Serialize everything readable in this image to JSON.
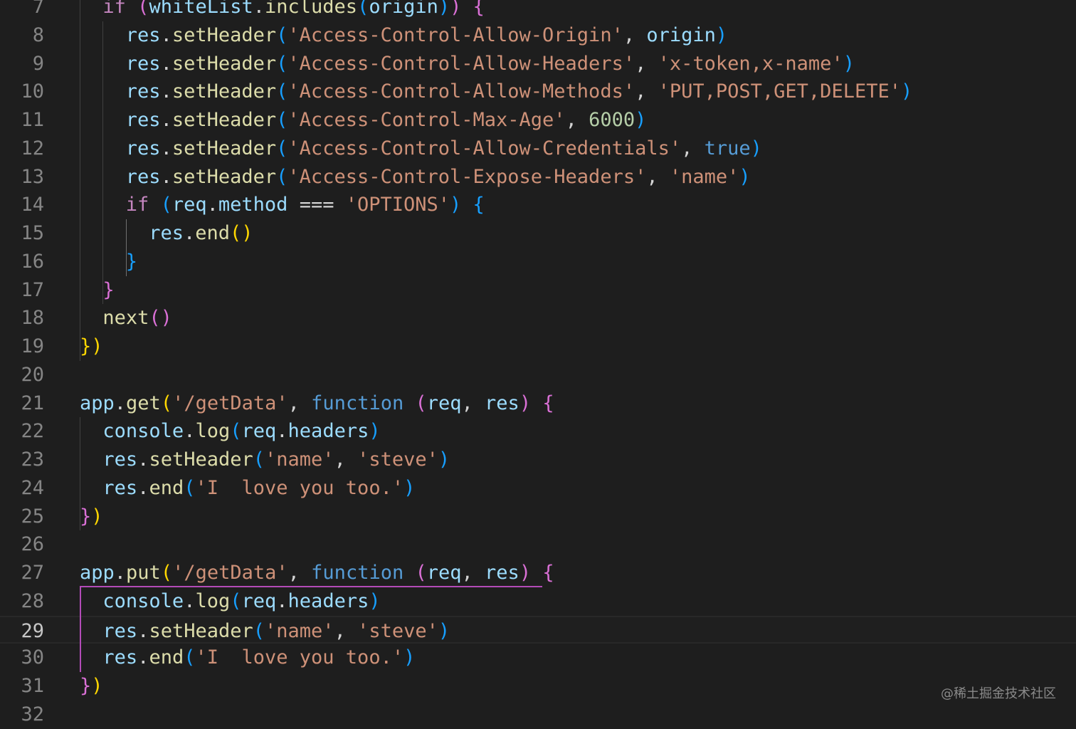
{
  "editor": {
    "line_numbers": [
      "7",
      "8",
      "9",
      "10",
      "11",
      "12",
      "13",
      "14",
      "15",
      "16",
      "17",
      "18",
      "19",
      "20",
      "21",
      "22",
      "23",
      "24",
      "25",
      "26",
      "27",
      "28",
      "29",
      "30",
      "31",
      "32"
    ],
    "current_line": "29",
    "lines": [
      [
        {
          "t": "if ",
          "c": "kw"
        },
        {
          "t": "(",
          "c": "b2"
        },
        {
          "t": "whiteList",
          "c": "var"
        },
        {
          "t": ".",
          "c": "plain"
        },
        {
          "t": "includes",
          "c": "fn"
        },
        {
          "t": "(",
          "c": "b3"
        },
        {
          "t": "origin",
          "c": "var"
        },
        {
          "t": ")",
          "c": "b3"
        },
        {
          "t": ")",
          "c": "b2"
        },
        {
          "t": " {",
          "c": "b2"
        }
      ],
      [
        {
          "t": "res",
          "c": "var"
        },
        {
          "t": ".",
          "c": "plain"
        },
        {
          "t": "setHeader",
          "c": "fn"
        },
        {
          "t": "(",
          "c": "b3"
        },
        {
          "t": "'Access-Control-Allow-Origin'",
          "c": "str"
        },
        {
          "t": ", ",
          "c": "plain"
        },
        {
          "t": "origin",
          "c": "var"
        },
        {
          "t": ")",
          "c": "b3"
        }
      ],
      [
        {
          "t": "res",
          "c": "var"
        },
        {
          "t": ".",
          "c": "plain"
        },
        {
          "t": "setHeader",
          "c": "fn"
        },
        {
          "t": "(",
          "c": "b3"
        },
        {
          "t": "'Access-Control-Allow-Headers'",
          "c": "str"
        },
        {
          "t": ", ",
          "c": "plain"
        },
        {
          "t": "'x-token,x-name'",
          "c": "str"
        },
        {
          "t": ")",
          "c": "b3"
        }
      ],
      [
        {
          "t": "res",
          "c": "var"
        },
        {
          "t": ".",
          "c": "plain"
        },
        {
          "t": "setHeader",
          "c": "fn"
        },
        {
          "t": "(",
          "c": "b3"
        },
        {
          "t": "'Access-Control-Allow-Methods'",
          "c": "str"
        },
        {
          "t": ", ",
          "c": "plain"
        },
        {
          "t": "'PUT,POST,GET,DELETE'",
          "c": "str"
        },
        {
          "t": ")",
          "c": "b3"
        }
      ],
      [
        {
          "t": "res",
          "c": "var"
        },
        {
          "t": ".",
          "c": "plain"
        },
        {
          "t": "setHeader",
          "c": "fn"
        },
        {
          "t": "(",
          "c": "b3"
        },
        {
          "t": "'Access-Control-Max-Age'",
          "c": "str"
        },
        {
          "t": ", ",
          "c": "plain"
        },
        {
          "t": "6000",
          "c": "num"
        },
        {
          "t": ")",
          "c": "b3"
        }
      ],
      [
        {
          "t": "res",
          "c": "var"
        },
        {
          "t": ".",
          "c": "plain"
        },
        {
          "t": "setHeader",
          "c": "fn"
        },
        {
          "t": "(",
          "c": "b3"
        },
        {
          "t": "'Access-Control-Allow-Credentials'",
          "c": "str"
        },
        {
          "t": ", ",
          "c": "plain"
        },
        {
          "t": "true",
          "c": "bool"
        },
        {
          "t": ")",
          "c": "b3"
        }
      ],
      [
        {
          "t": "res",
          "c": "var"
        },
        {
          "t": ".",
          "c": "plain"
        },
        {
          "t": "setHeader",
          "c": "fn"
        },
        {
          "t": "(",
          "c": "b3"
        },
        {
          "t": "'Access-Control-Expose-Headers'",
          "c": "str"
        },
        {
          "t": ", ",
          "c": "plain"
        },
        {
          "t": "'name'",
          "c": "str"
        },
        {
          "t": ")",
          "c": "b3"
        }
      ],
      [
        {
          "t": "if ",
          "c": "kw"
        },
        {
          "t": "(",
          "c": "b3"
        },
        {
          "t": "req",
          "c": "var"
        },
        {
          "t": ".",
          "c": "plain"
        },
        {
          "t": "method",
          "c": "var"
        },
        {
          "t": " === ",
          "c": "plain"
        },
        {
          "t": "'OPTIONS'",
          "c": "str"
        },
        {
          "t": ")",
          "c": "b3"
        },
        {
          "t": " {",
          "c": "b3"
        }
      ],
      [
        {
          "t": "res",
          "c": "var"
        },
        {
          "t": ".",
          "c": "plain"
        },
        {
          "t": "end",
          "c": "fn"
        },
        {
          "t": "()",
          "c": "b1"
        }
      ],
      [
        {
          "t": "}",
          "c": "b3"
        }
      ],
      [
        {
          "t": "}",
          "c": "b2"
        }
      ],
      [
        {
          "t": "next",
          "c": "fn"
        },
        {
          "t": "()",
          "c": "b2"
        }
      ],
      [
        {
          "t": "}",
          "c": "b1"
        },
        {
          "t": ")",
          "c": "b1"
        }
      ],
      [],
      [
        {
          "t": "app",
          "c": "var"
        },
        {
          "t": ".",
          "c": "plain"
        },
        {
          "t": "get",
          "c": "fn"
        },
        {
          "t": "(",
          "c": "b1"
        },
        {
          "t": "'/getData'",
          "c": "str"
        },
        {
          "t": ", ",
          "c": "plain"
        },
        {
          "t": "function",
          "c": "func"
        },
        {
          "t": " (",
          "c": "b2"
        },
        {
          "t": "req",
          "c": "var"
        },
        {
          "t": ", ",
          "c": "plain"
        },
        {
          "t": "res",
          "c": "var"
        },
        {
          "t": ")",
          "c": "b2"
        },
        {
          "t": " {",
          "c": "b2"
        }
      ],
      [
        {
          "t": "console",
          "c": "var"
        },
        {
          "t": ".",
          "c": "plain"
        },
        {
          "t": "log",
          "c": "fn"
        },
        {
          "t": "(",
          "c": "b3"
        },
        {
          "t": "req",
          "c": "var"
        },
        {
          "t": ".",
          "c": "plain"
        },
        {
          "t": "headers",
          "c": "var"
        },
        {
          "t": ")",
          "c": "b3"
        }
      ],
      [
        {
          "t": "res",
          "c": "var"
        },
        {
          "t": ".",
          "c": "plain"
        },
        {
          "t": "setHeader",
          "c": "fn"
        },
        {
          "t": "(",
          "c": "b3"
        },
        {
          "t": "'name'",
          "c": "str"
        },
        {
          "t": ", ",
          "c": "plain"
        },
        {
          "t": "'steve'",
          "c": "str"
        },
        {
          "t": ")",
          "c": "b3"
        }
      ],
      [
        {
          "t": "res",
          "c": "var"
        },
        {
          "t": ".",
          "c": "plain"
        },
        {
          "t": "end",
          "c": "fn"
        },
        {
          "t": "(",
          "c": "b3"
        },
        {
          "t": "'I  love you too.'",
          "c": "str"
        },
        {
          "t": ")",
          "c": "b3"
        }
      ],
      [
        {
          "t": "}",
          "c": "b2"
        },
        {
          "t": ")",
          "c": "b1"
        }
      ],
      [],
      [
        {
          "t": "app",
          "c": "var"
        },
        {
          "t": ".",
          "c": "plain"
        },
        {
          "t": "put",
          "c": "fn"
        },
        {
          "t": "(",
          "c": "b1"
        },
        {
          "t": "'/getData'",
          "c": "str"
        },
        {
          "t": ", ",
          "c": "plain"
        },
        {
          "t": "function",
          "c": "func"
        },
        {
          "t": " (",
          "c": "b2"
        },
        {
          "t": "req",
          "c": "var"
        },
        {
          "t": ", ",
          "c": "plain"
        },
        {
          "t": "res",
          "c": "var"
        },
        {
          "t": ")",
          "c": "b2"
        },
        {
          "t": " {",
          "c": "b2"
        }
      ],
      [
        {
          "t": "console",
          "c": "var"
        },
        {
          "t": ".",
          "c": "plain"
        },
        {
          "t": "log",
          "c": "fn"
        },
        {
          "t": "(",
          "c": "b3"
        },
        {
          "t": "req",
          "c": "var"
        },
        {
          "t": ".",
          "c": "plain"
        },
        {
          "t": "headers",
          "c": "var"
        },
        {
          "t": ")",
          "c": "b3"
        }
      ],
      [
        {
          "t": "res",
          "c": "var"
        },
        {
          "t": ".",
          "c": "plain"
        },
        {
          "t": "setHeader",
          "c": "fn"
        },
        {
          "t": "(",
          "c": "b3"
        },
        {
          "t": "'name'",
          "c": "str"
        },
        {
          "t": ", ",
          "c": "plain"
        },
        {
          "t": "'steve'",
          "c": "str"
        },
        {
          "t": ")",
          "c": "b3"
        }
      ],
      [
        {
          "t": "res",
          "c": "var"
        },
        {
          "t": ".",
          "c": "plain"
        },
        {
          "t": "end",
          "c": "fn"
        },
        {
          "t": "(",
          "c": "b3"
        },
        {
          "t": "'I  love you too.'",
          "c": "str"
        },
        {
          "t": ")",
          "c": "b3"
        }
      ],
      [
        {
          "t": "}",
          "c": "b2"
        },
        {
          "t": ")",
          "c": "b1"
        }
      ],
      []
    ]
  },
  "watermark": "@稀土掘金技术社区"
}
